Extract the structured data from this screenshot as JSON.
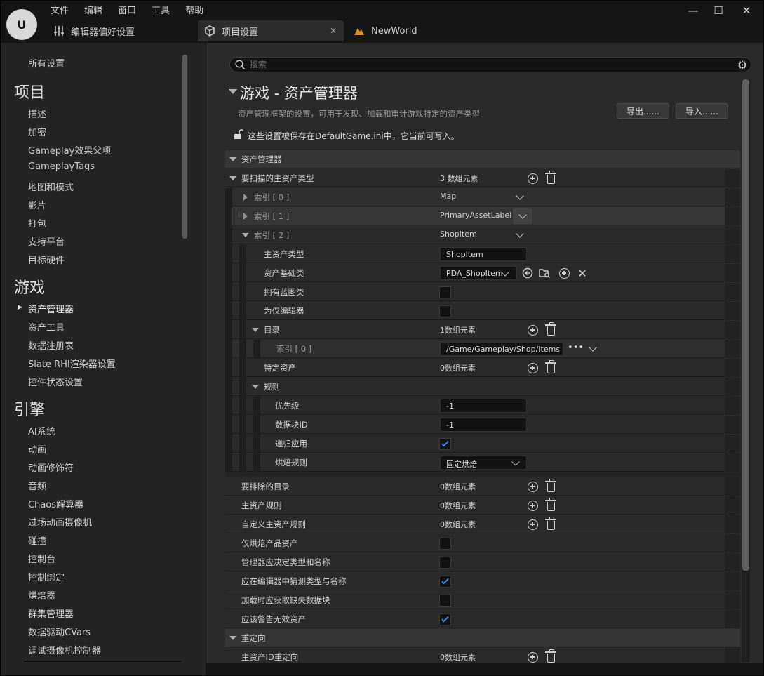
{
  "menu": [
    "文件",
    "编辑",
    "窗口",
    "工具",
    "帮助"
  ],
  "tabs": {
    "editor_prefs": "编辑器偏好设置",
    "project_settings": "项目设置",
    "world": "NewWorld"
  },
  "window_controls": {
    "minimize": "—",
    "maximize": "☐",
    "close": "✕"
  },
  "sidebar": {
    "all_settings": "所有设置",
    "sections": [
      {
        "title": "项目",
        "items": [
          "描述",
          "加密",
          "Gameplay效果父项",
          "GameplayTags",
          "地图和模式",
          "影片",
          "打包",
          "支持平台",
          "目标硬件"
        ]
      },
      {
        "title": "游戏",
        "items": [
          "资产管理器",
          "资产工具",
          "数据注册表",
          "Slate RHI渲染器设置",
          "控件状态设置"
        ]
      },
      {
        "title": "引擎",
        "items": [
          "AI系统",
          "动画",
          "动画修饰符",
          "音频",
          "Chaos解算器",
          "过场动画摄像机",
          "碰撞",
          "控制台",
          "控制绑定",
          "烘焙器",
          "群集管理器",
          "数据驱动CVars",
          "调试摄像机控制器"
        ]
      }
    ],
    "selected": "资产管理器"
  },
  "search": {
    "placeholder": "搜索"
  },
  "page": {
    "title": "游戏 - 资产管理器",
    "description": "资产管理框架的设置，可用于发现、加载和审计游戏特定的资产类型",
    "export_label": "导出......",
    "import_label": "导入......",
    "save_note": "这些设置被保存在DefaultGame.ini中，它当前可写入。"
  },
  "props": {
    "category_asset_manager": "资产管理器",
    "primary_types_to_scan": "要扫描的主资产类型",
    "primary_types_count": "3 数组元素",
    "index0": "索引 [ 0 ]",
    "index0_value": "Map",
    "index1": "索引 [ 1 ]",
    "index1_value": "PrimaryAssetLabel",
    "index2": "索引 [ 2 ]",
    "index2_value": "ShopItem",
    "primary_asset_type": "主资产类型",
    "primary_asset_type_value": "ShopItem",
    "asset_base_class": "资产基础类",
    "asset_base_class_value": "PDA_ShopItem",
    "has_blueprint_classes": "拥有蓝图类",
    "is_editor_only": "为仅编辑器",
    "directories": "目录",
    "directories_count": "1数组元素",
    "dir_index0": "索引 [ 0 ]",
    "dir_index0_value": "/Game/Gameplay/Shop/Items",
    "specific_assets": "特定资产",
    "specific_assets_count": "0数组元素",
    "rules": "规则",
    "priority": "优先级",
    "priority_value": "-1",
    "chunk_id": "数据块ID",
    "chunk_id_value": "-1",
    "apply_recursively": "递归应用",
    "cook_rule": "烘焙规则",
    "cook_rule_value": "固定烘焙",
    "dirs_to_exclude": "要排除的目录",
    "dirs_to_exclude_count": "0数组元素",
    "primary_asset_rules": "主资产规则",
    "primary_asset_rules_count": "0数组元素",
    "custom_primary_asset_rules": "自定义主资产规则",
    "custom_primary_asset_rules_count": "0数组元素",
    "only_cook_production_assets": "仅烘焙产品资产",
    "should_manager_determine_type": "管理器应决定类型和名称",
    "should_guess_type_in_editor": "应在编辑器中猜测类型与名称",
    "get_missing_chunks_on_load": "加载时应获取缺失数据块",
    "should_warn_invalid_assets": "应该警告无效资产",
    "category_redirects": "重定向",
    "primary_asset_id_redirects": "主资产ID重定向",
    "primary_asset_id_redirects_count": "0数组元素"
  },
  "checks": {
    "has_blueprint_classes": false,
    "is_editor_only": false,
    "apply_recursively": true,
    "only_cook_production_assets": false,
    "should_manager_determine_type": false,
    "should_guess_type_in_editor": true,
    "get_missing_chunks_on_load": false,
    "should_warn_invalid_assets": true
  },
  "icons": {
    "search": "search-icon",
    "gear": "gear-icon",
    "lock": "unlock-icon"
  }
}
